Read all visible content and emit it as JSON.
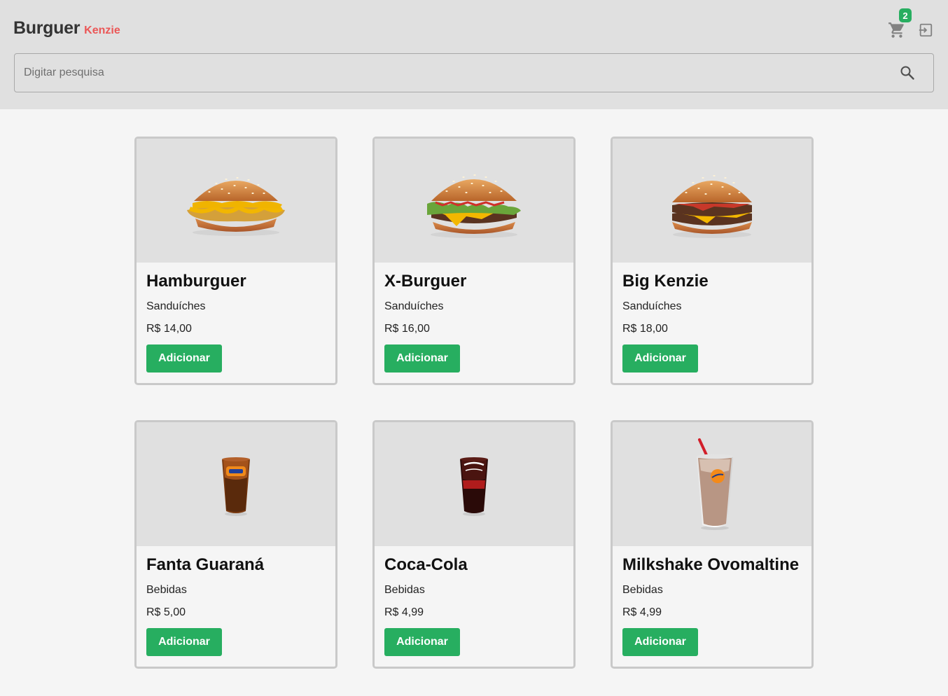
{
  "header": {
    "logo_main": "Burguer",
    "logo_sub": "Kenzie",
    "cart_count": "2",
    "cart_icon": "cart-icon",
    "logout_icon": "logout-icon"
  },
  "search": {
    "placeholder": "Digitar pesquisa",
    "value": "",
    "icon": "search-icon"
  },
  "products": [
    {
      "name": "Hamburguer",
      "category": "Sanduíches",
      "price": "R$ 14,00",
      "button": "Adicionar",
      "image": "hamburger-image"
    },
    {
      "name": "X-Burguer",
      "category": "Sanduíches",
      "price": "R$ 16,00",
      "button": "Adicionar",
      "image": "x-burger-image"
    },
    {
      "name": "Big Kenzie",
      "category": "Sanduíches",
      "price": "R$ 18,00",
      "button": "Adicionar",
      "image": "big-kenzie-image"
    },
    {
      "name": "Fanta Guaraná",
      "category": "Bebidas",
      "price": "R$ 5,00",
      "button": "Adicionar",
      "image": "fanta-cup-image"
    },
    {
      "name": "Coca-Cola",
      "category": "Bebidas",
      "price": "R$ 4,99",
      "button": "Adicionar",
      "image": "coca-cola-cup-image"
    },
    {
      "name": "Milkshake Ovomaltine",
      "category": "Bebidas",
      "price": "R$ 4,99",
      "button": "Adicionar",
      "image": "milkshake-image"
    }
  ],
  "colors": {
    "primary": "#27ae60",
    "secondary": "#eb5757",
    "header_bg": "#e0e0e0",
    "page_bg": "#f5f5f5"
  }
}
